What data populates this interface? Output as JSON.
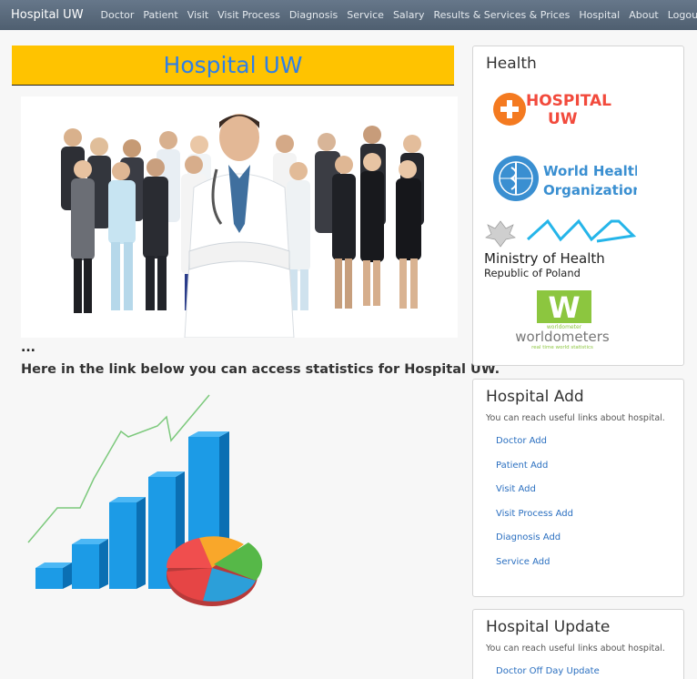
{
  "navbar": {
    "brand": "Hospital UW",
    "left_items": [
      "Doctor",
      "Patient",
      "Visit",
      "Visit Process",
      "Diagnosis",
      "Service",
      "Salary",
      "Results & Services & Prices"
    ],
    "right_items": [
      "Hospital",
      "About",
      "Logout"
    ]
  },
  "main": {
    "title": "Hospital UW",
    "ellipsis": "...",
    "stats_text": "Here in the link below you can access statistics for Hospital UW."
  },
  "health_panel": {
    "heading": "Health",
    "logos": {
      "hospital_line1": "HOSPITAL",
      "hospital_line2": "UW",
      "who_line1": "World Health",
      "who_line2": "Organization",
      "moh_line1": "Ministry of Health",
      "moh_line2": "Republic of Poland",
      "wm_small": "worldometer",
      "wm_main": "worldometers",
      "wm_sub": "real time world statistics"
    }
  },
  "add_panel": {
    "heading": "Hospital Add",
    "description": "You can reach useful links about hospital.",
    "links": [
      "Doctor Add",
      "Patient Add",
      "Visit Add",
      "Visit Process Add",
      "Diagnosis Add",
      "Service Add"
    ]
  },
  "update_panel": {
    "heading": "Hospital Update",
    "description": "You can reach useful links about hospital.",
    "links": [
      "Doctor Off Day Update"
    ]
  },
  "colors": {
    "accent_yellow": "#ffc300",
    "title_blue": "#2f7fe6",
    "link_blue": "#2a6fc0",
    "nav_bg": "#5a6a7b"
  },
  "icons": [
    "plus-icon",
    "who-emblem-icon",
    "eagle-icon",
    "wave-icon",
    "w-icon",
    "bar-chart-icon",
    "pie-chart-icon"
  ]
}
